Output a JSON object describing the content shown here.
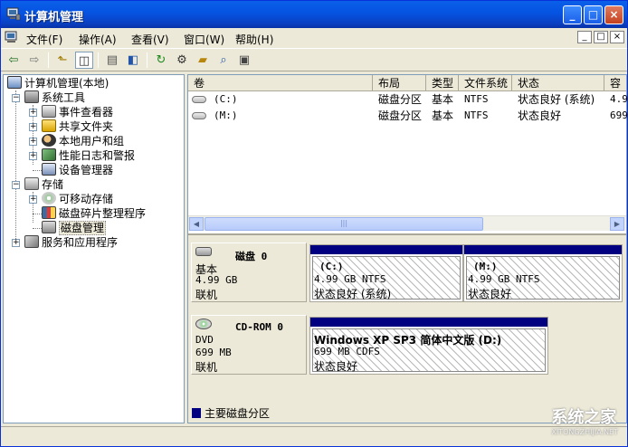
{
  "window": {
    "title": "计算机管理",
    "buttons": {
      "minimize": "_",
      "maximize": "□",
      "close": "×"
    }
  },
  "menu": {
    "items": [
      "文件(F)",
      "操作(A)",
      "查看(V)",
      "窗口(W)",
      "帮助(H)"
    ],
    "mdi_buttons": [
      "_",
      "□",
      "×"
    ]
  },
  "toolbar": {
    "icons": [
      "back-arrow-icon",
      "forward-arrow-icon",
      "up-folder-icon",
      "show-hide-tree-icon",
      "properties-icon",
      "help-icon",
      "refresh-icon",
      "settings-icon",
      "open-icon",
      "search-icon",
      "export-icon"
    ]
  },
  "tree": {
    "root": "计算机管理(本地)",
    "system_tools": "系统工具",
    "event_viewer": "事件查看器",
    "shared_folders": "共享文件夹",
    "local_users": "本地用户和组",
    "perf_logs": "性能日志和警报",
    "device_manager": "设备管理器",
    "storage": "存储",
    "removable_storage": "可移动存储",
    "defrag": "磁盘碎片整理程序",
    "disk_management": "磁盘管理",
    "services_apps": "服务和应用程序"
  },
  "list": {
    "columns": [
      "卷",
      "布局",
      "类型",
      "文件系统",
      "状态",
      "容"
    ],
    "rows": [
      {
        "volume": "(C:)",
        "layout": "磁盘分区",
        "type": "基本",
        "fs": "NTFS",
        "status": "状态良好 (系统)",
        "capacity": "4.9"
      },
      {
        "volume": "(M:)",
        "layout": "磁盘分区",
        "type": "基本",
        "fs": "NTFS",
        "status": "状态良好",
        "capacity": "699"
      }
    ]
  },
  "disks": [
    {
      "name": "磁盘 0",
      "kind": "基本",
      "size": "4.99 GB",
      "state": "联机",
      "volumes": [
        {
          "name": "(C:)",
          "detail": "4.99 GB NTFS",
          "status": "状态良好 (系统)"
        },
        {
          "name": "(M:)",
          "detail": "4.99 GB NTFS",
          "status": "状态良好"
        }
      ]
    },
    {
      "name": "CD-ROM 0",
      "kind": "DVD",
      "size": "699 MB",
      "state": "联机",
      "volumes": [
        {
          "name": "Windows XP SP3 简体中文版  (D:)",
          "detail": "699 MB CDFS",
          "status": "状态良好"
        }
      ]
    }
  ],
  "legend": {
    "primary_partition": "主要磁盘分区",
    "color": "#000080"
  },
  "watermark": {
    "text": "系统之家",
    "sub": "XITONGZHIJIA.NET"
  }
}
